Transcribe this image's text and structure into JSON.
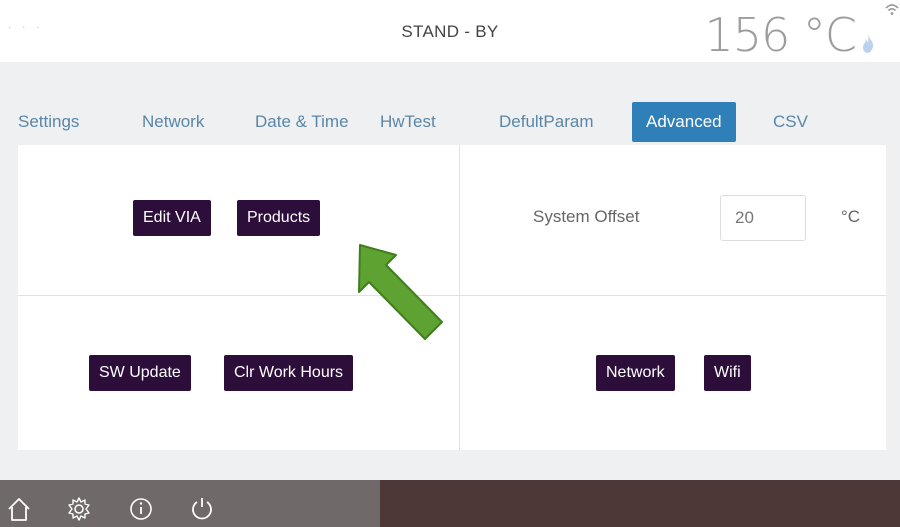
{
  "header": {
    "status": "STAND - BY",
    "temperature": "156 °C",
    "icons": [
      "flame-icon",
      "wifi-icon"
    ]
  },
  "tabs": [
    {
      "label": "Settings",
      "active": false
    },
    {
      "label": "Network",
      "active": false
    },
    {
      "label": "Date & Time",
      "active": false
    },
    {
      "label": "HwTest",
      "active": false
    },
    {
      "label": "DefultParam",
      "active": false
    },
    {
      "label": "Advanced",
      "active": true
    },
    {
      "label": "CSV",
      "active": false
    }
  ],
  "panel": {
    "top_left": {
      "buttons": [
        "Edit VIA",
        "Products"
      ]
    },
    "top_right": {
      "label": "System Offset",
      "value": "20",
      "unit": "°C"
    },
    "bottom_left": {
      "buttons": [
        "SW Update",
        "Clr Work Hours"
      ]
    },
    "bottom_right": {
      "buttons": [
        "Network",
        "Wifi"
      ]
    }
  },
  "footer": {
    "icons": [
      "home-icon",
      "gear-icon",
      "info-icon",
      "power-icon"
    ]
  },
  "colors": {
    "accent": "#2f7fb8",
    "button": "#2d0e3a",
    "arrow": "#5ea232",
    "footer": "#4e3737"
  }
}
